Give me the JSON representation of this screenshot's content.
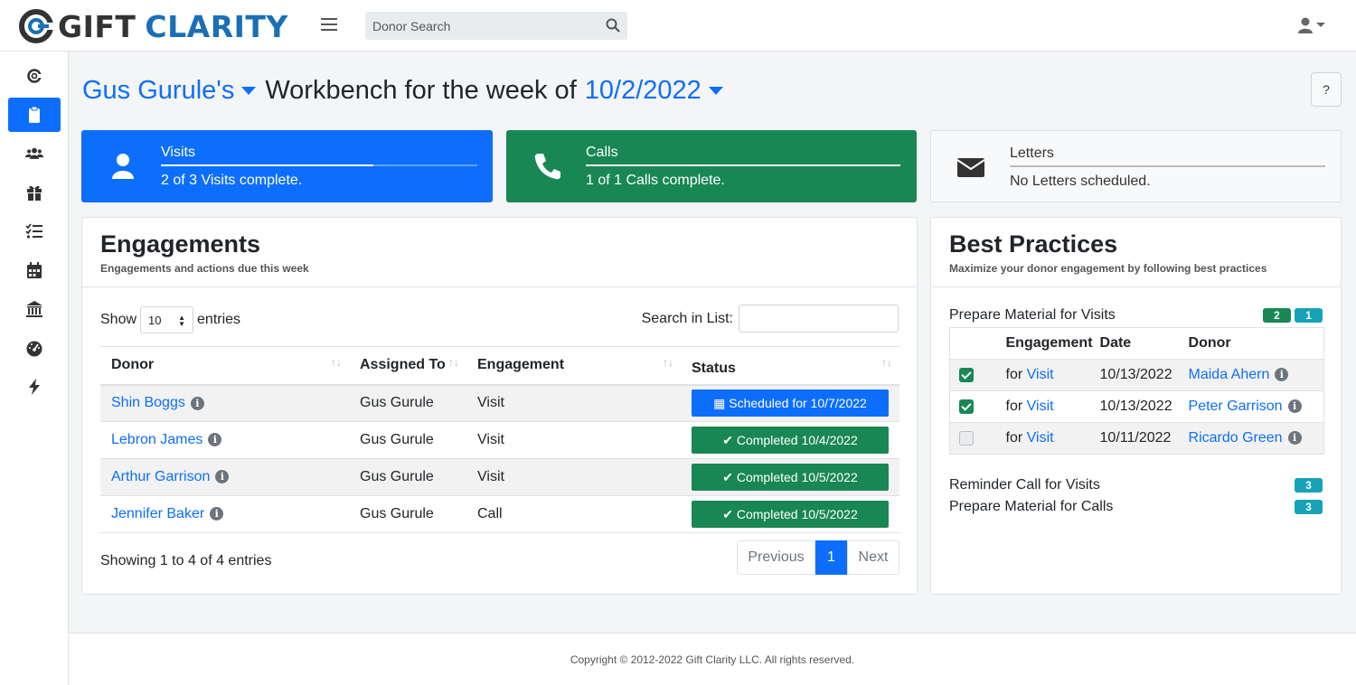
{
  "brand": {
    "gift": "GIFT",
    "clarity": "CLARITY",
    "primary_color": "#0d6efd",
    "success_color": "#198754",
    "info_color": "#17a2b8"
  },
  "search": {
    "placeholder": "Donor Search",
    "value": ""
  },
  "sidebar": {
    "items": [
      {
        "icon": "logo-icon",
        "active": false
      },
      {
        "icon": "clipboard-icon",
        "active": true
      },
      {
        "icon": "users-icon",
        "active": false
      },
      {
        "icon": "gift-icon",
        "active": false
      },
      {
        "icon": "tasks-icon",
        "active": false
      },
      {
        "icon": "calendar-icon",
        "active": false
      },
      {
        "icon": "bank-icon",
        "active": false
      },
      {
        "icon": "gauge-icon",
        "active": false
      },
      {
        "icon": "bolt-icon",
        "active": false
      }
    ]
  },
  "header": {
    "owner": "Gus Gurule's",
    "middle": "Workbench for the week of",
    "week": "10/2/2022",
    "help": "?"
  },
  "summary": {
    "visits": {
      "title": "Visits",
      "desc": "2 of 3 Visits complete.",
      "progress": 0.67,
      "icon": "user-icon"
    },
    "calls": {
      "title": "Calls",
      "desc": "1 of 1 Calls complete.",
      "progress": 1.0,
      "icon": "phone-icon"
    },
    "letters": {
      "title": "Letters",
      "desc": "No Letters scheduled.",
      "progress": 0,
      "icon": "envelope-icon"
    }
  },
  "engagements": {
    "title": "Engagements",
    "subtitle": "Engagements and actions due this week",
    "show_label": "Show",
    "entries_value": "10",
    "entries_label": "entries",
    "search_label": "Search in List:",
    "columns": [
      "Donor",
      "Assigned To",
      "Engagement",
      "Status"
    ],
    "rows": [
      {
        "donor": "Shin Boggs",
        "assigned": "Gus Gurule",
        "engagement": "Visit",
        "status": "Scheduled for 10/7/2022",
        "status_type": "scheduled"
      },
      {
        "donor": "Lebron James",
        "assigned": "Gus Gurule",
        "engagement": "Visit",
        "status": "Completed 10/4/2022",
        "status_type": "completed"
      },
      {
        "donor": "Arthur Garrison",
        "assigned": "Gus Gurule",
        "engagement": "Visit",
        "status": "Completed 10/5/2022",
        "status_type": "completed"
      },
      {
        "donor": "Jennifer Baker",
        "assigned": "Gus Gurule",
        "engagement": "Call",
        "status": "Completed 10/5/2022",
        "status_type": "completed"
      }
    ],
    "showing": "Showing 1 to 4 of 4 entries",
    "pager": {
      "previous": "Previous",
      "page": "1",
      "next": "Next"
    }
  },
  "best_practices": {
    "title": "Best Practices",
    "subtitle": "Maximize your donor engagement by following best practices",
    "prepare_visits": {
      "label": "Prepare Material for Visits",
      "badge_done": "2",
      "badge_pending": "1"
    },
    "columns": [
      "Engagement",
      "Date",
      "Donor"
    ],
    "rows": [
      {
        "checked": true,
        "prefix": "for",
        "engagement": "Visit",
        "date": "10/13/2022",
        "donor": "Maida Ahern"
      },
      {
        "checked": true,
        "prefix": "for",
        "engagement": "Visit",
        "date": "10/13/2022",
        "donor": "Peter Garrison"
      },
      {
        "checked": false,
        "prefix": "for",
        "engagement": "Visit",
        "date": "10/11/2022",
        "donor": "Ricardo Green"
      }
    ],
    "reminder_calls": {
      "label": "Reminder Call for Visits",
      "badge": "3"
    },
    "prepare_calls": {
      "label": "Prepare Material for Calls",
      "badge": "3"
    }
  },
  "footer": {
    "text": "Copyright © 2012-2022 Gift Clarity LLC. All rights reserved."
  }
}
